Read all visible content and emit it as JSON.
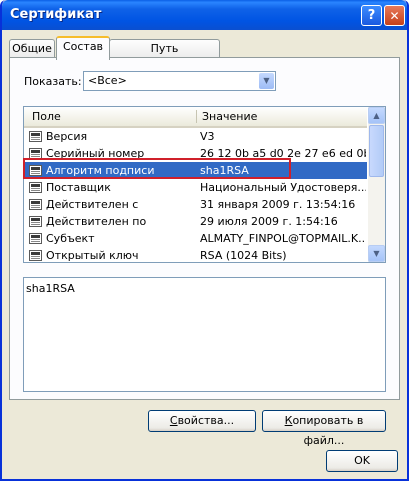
{
  "window": {
    "title": "Сертификат"
  },
  "tabs": [
    {
      "label": "Общие",
      "active": false
    },
    {
      "label": "Состав",
      "active": true
    },
    {
      "label": "Путь сертификации",
      "active": false
    }
  ],
  "filter": {
    "label": "Показать:",
    "value": "<Все>"
  },
  "list": {
    "columns": {
      "field": "Поле",
      "value": "Значение"
    },
    "rows": [
      {
        "field": "Версия",
        "value": "V3"
      },
      {
        "field": "Серийный номер",
        "value": "26 12 0b a5 d0 2e 27 e6 ed 0b..."
      },
      {
        "field": "Алгоритм подписи",
        "value": "sha1RSA",
        "selected": true
      },
      {
        "field": "Поставщик",
        "value": "Национальный Удостоверя..."
      },
      {
        "field": "Действителен с",
        "value": "31 января 2009 г. 13:54:16"
      },
      {
        "field": "Действителен по",
        "value": "29 июля 2009 г. 1:54:16"
      },
      {
        "field": "Субъект",
        "value": "ALMATY_FINPOL@TOPMAIL.K..."
      },
      {
        "field": "Открытый ключ",
        "value": "RSA (1024 Bits)"
      }
    ]
  },
  "detail": {
    "text": "sha1RSA"
  },
  "buttons": {
    "properties_pre": "",
    "properties_hot": "С",
    "properties_post": "войства...",
    "copy_pre": "",
    "copy_hot": "К",
    "copy_post": "опировать в файл...",
    "ok": "OK"
  },
  "colors": {
    "titlebar": "#0054e3",
    "selection": "#316ac5",
    "highlight_border": "#d0202a",
    "dialog_bg": "#ece9d8"
  }
}
